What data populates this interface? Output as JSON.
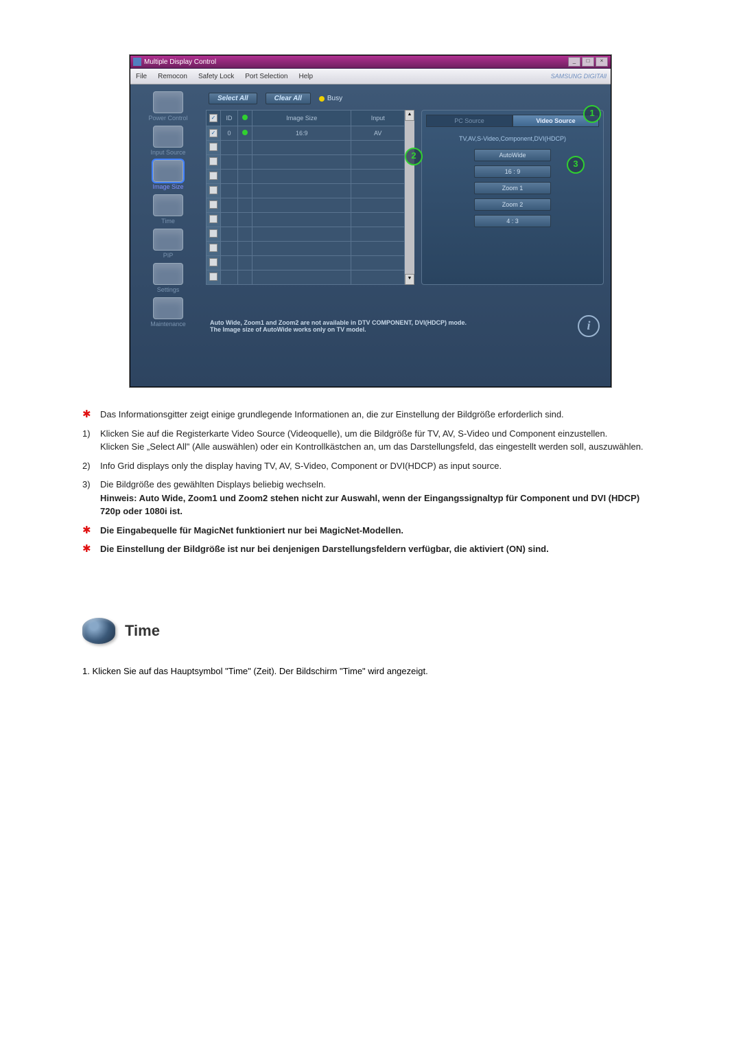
{
  "window": {
    "title": "Multiple Display Control",
    "menubar": [
      "File",
      "Remocon",
      "Safety Lock",
      "Port Selection",
      "Help"
    ],
    "brand": "SAMSUNG DIGITAll"
  },
  "sidebar": {
    "items": [
      {
        "label": "Power Control"
      },
      {
        "label": "Input Source"
      },
      {
        "label": "Image Size"
      },
      {
        "label": "Time"
      },
      {
        "label": "PIP"
      },
      {
        "label": "Settings"
      },
      {
        "label": "Maintenance"
      }
    ],
    "active_index": 2
  },
  "toolbar": {
    "select_all": "Select All",
    "clear_all": "Clear All",
    "busy": "Busy"
  },
  "grid": {
    "headers": {
      "chk": "",
      "id": "ID",
      "power": "",
      "size": "Image Size",
      "input": "Input"
    },
    "rows": [
      {
        "checked": true,
        "id": "0",
        "power": true,
        "size": "16:9",
        "input": "AV"
      },
      {
        "checked": false,
        "id": "",
        "power": false,
        "size": "",
        "input": ""
      },
      {
        "checked": false,
        "id": "",
        "power": false,
        "size": "",
        "input": ""
      },
      {
        "checked": false,
        "id": "",
        "power": false,
        "size": "",
        "input": ""
      },
      {
        "checked": false,
        "id": "",
        "power": false,
        "size": "",
        "input": ""
      },
      {
        "checked": false,
        "id": "",
        "power": false,
        "size": "",
        "input": ""
      },
      {
        "checked": false,
        "id": "",
        "power": false,
        "size": "",
        "input": ""
      },
      {
        "checked": false,
        "id": "",
        "power": false,
        "size": "",
        "input": ""
      },
      {
        "checked": false,
        "id": "",
        "power": false,
        "size": "",
        "input": ""
      },
      {
        "checked": false,
        "id": "",
        "power": false,
        "size": "",
        "input": ""
      },
      {
        "checked": false,
        "id": "",
        "power": false,
        "size": "",
        "input": ""
      }
    ]
  },
  "panel": {
    "tabs": {
      "pc": "PC Source",
      "video": "Video Source"
    },
    "subtitle": "TV,AV,S-Video,Component,DVI(HDCP)",
    "options": [
      "AutoWide",
      "16 : 9",
      "Zoom 1",
      "Zoom 2",
      "4 : 3"
    ]
  },
  "callouts": {
    "c1": "1",
    "c2": "2",
    "c3": "3"
  },
  "footer": {
    "line1": "Auto Wide, Zoom1 and Zoom2 are not available in DTV COMPONENT, DVI(HDCP) mode.",
    "line2": "The Image size of AutoWide works only on TV model."
  },
  "explain": {
    "p_star1": "Das Informationsgitter zeigt einige grundlegende Informationen an, die zur Einstellung der Bildgröße erforderlich sind.",
    "p_1a": "Klicken Sie auf die Registerkarte Video Source (Videoquelle), um die Bildgröße für TV, AV, S-Video und Component einzustellen.",
    "p_1b": "Klicken Sie „Select All\" (Alle auswählen) oder ein Kontrollkästchen an, um das Darstellungsfeld, das eingestellt werden soll, auszuwählen.",
    "p_2": "Info Grid displays only the display having TV, AV, S-Video, Component or DVI(HDCP) as input source.",
    "p_3": "Die Bildgröße des gewählten Displays beliebig wechseln.",
    "p_3b": "Hinweis: Auto Wide, Zoom1 und Zoom2 stehen nicht zur Auswahl, wenn der Eingangssignaltyp für Component und DVI (HDCP) 720p oder 1080i ist.",
    "p_star2": "Die Eingabequelle für MagicNet funktioniert nur bei MagicNet-Modellen.",
    "p_star3": "Die Einstellung der Bildgröße ist nur bei denjenigen Darstellungsfeldern verfügbar, die aktiviert (ON) sind."
  },
  "time_section": {
    "title": "Time",
    "body": "1.  Klicken Sie auf das Hauptsymbol \"Time\" (Zeit). Der Bildschirm \"Time\" wird angezeigt."
  }
}
